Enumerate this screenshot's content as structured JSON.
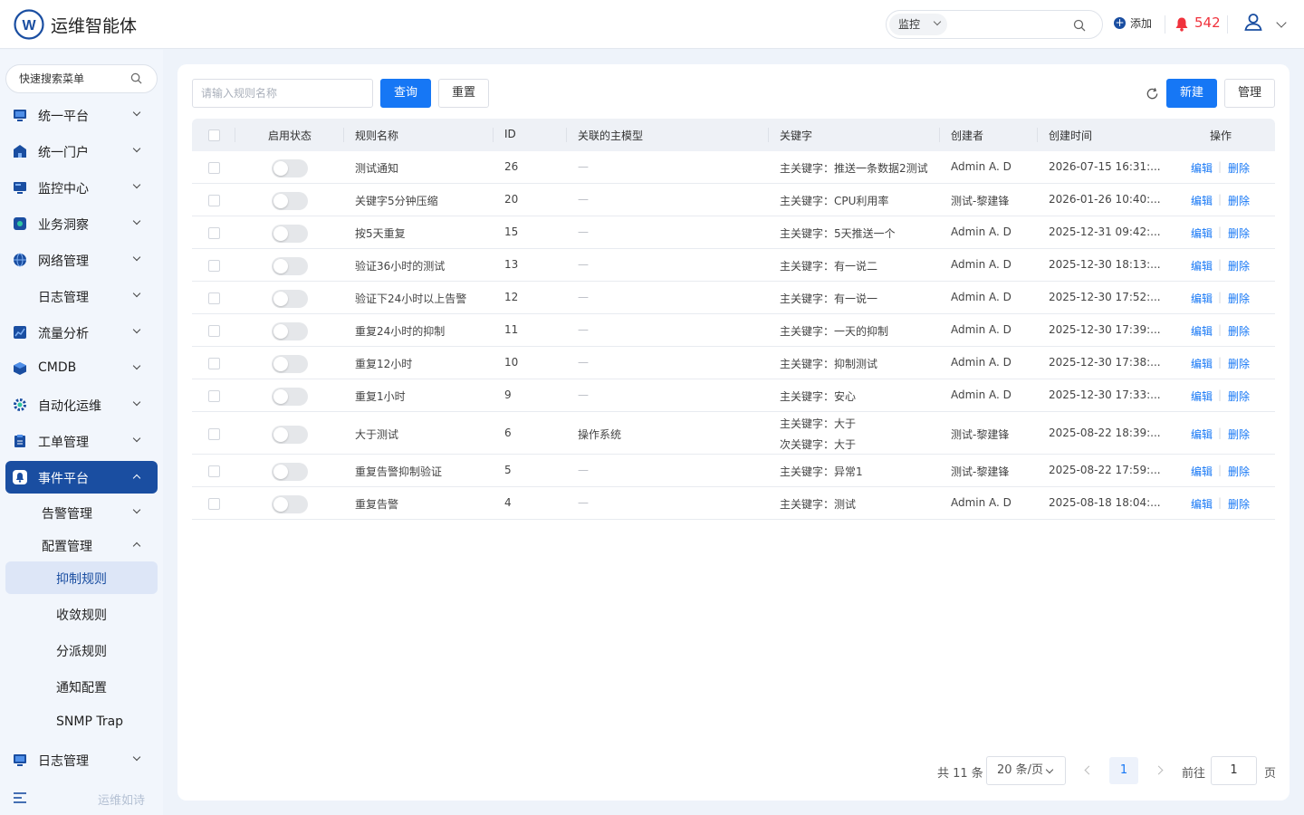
{
  "app": {
    "title": "运维智能体"
  },
  "header": {
    "search_scope": "监控",
    "add_label": "添加",
    "alert_count": "542"
  },
  "sidebar": {
    "search_placeholder": "快速搜索菜单",
    "items": [
      {
        "label": "统一平台",
        "icon": "monitor-icon"
      },
      {
        "label": "统一门户",
        "icon": "home-icon"
      },
      {
        "label": "监控中心",
        "icon": "monitor-icon"
      },
      {
        "label": "业务洞察",
        "icon": "insight-icon"
      },
      {
        "label": "网络管理",
        "icon": "globe-icon"
      },
      {
        "label": "日志管理",
        "icon": ""
      },
      {
        "label": "流量分析",
        "icon": "chart-icon"
      },
      {
        "label": "CMDB",
        "icon": "cube-icon"
      },
      {
        "label": "自动化运维",
        "icon": "gear-icon"
      },
      {
        "label": "工单管理",
        "icon": "clipboard-icon"
      },
      {
        "label": "事件平台",
        "icon": "bell-icon"
      }
    ],
    "sub_items": [
      {
        "label": "告警管理"
      },
      {
        "label": "配置管理"
      }
    ],
    "leaf_items": [
      {
        "label": "抑制规则"
      },
      {
        "label": "收敛规则"
      },
      {
        "label": "分派规则"
      },
      {
        "label": "通知配置"
      },
      {
        "label": "SNMP Trap"
      }
    ],
    "bottom_item": {
      "label": "日志管理",
      "icon": "monitor-icon"
    },
    "footer_text": "运维如诗"
  },
  "toolbar": {
    "rule_input_placeholder": "请输入规则名称",
    "query_label": "查询",
    "reset_label": "重置",
    "new_label": "新建",
    "manage_label": "管理"
  },
  "table": {
    "columns": [
      "启用状态",
      "规则名称",
      "ID",
      "关联的主模型",
      "关键字",
      "创建者",
      "创建时间",
      "操作"
    ],
    "edit_label": "编辑",
    "delete_label": "删除",
    "link_sep": "|",
    "rows": [
      {
        "enabled": false,
        "name": "测试通知",
        "id": "26",
        "model": "—",
        "keywords": [
          "主关键字：推送一条数据2测试"
        ],
        "creator": "Admin A. D",
        "created": "2026-07-15 16:31:..."
      },
      {
        "enabled": false,
        "name": "关键字5分钟压缩",
        "id": "20",
        "model": "—",
        "keywords": [
          "主关键字：CPU利用率"
        ],
        "creator": "测试-黎建锋",
        "created": "2026-01-26 10:40:..."
      },
      {
        "enabled": false,
        "name": "按5天重复",
        "id": "15",
        "model": "—",
        "keywords": [
          "主关键字：5天推送一个"
        ],
        "creator": "Admin A. D",
        "created": "2025-12-31 09:42:..."
      },
      {
        "enabled": false,
        "name": "验证36小时的测试",
        "id": "13",
        "model": "—",
        "keywords": [
          "主关键字：有一说二"
        ],
        "creator": "Admin A. D",
        "created": "2025-12-30 18:13:..."
      },
      {
        "enabled": false,
        "name": "验证下24小时以上告警",
        "id": "12",
        "model": "—",
        "keywords": [
          "主关键字：有一说一"
        ],
        "creator": "Admin A. D",
        "created": "2025-12-30 17:52:..."
      },
      {
        "enabled": false,
        "name": "重复24小时的抑制",
        "id": "11",
        "model": "—",
        "keywords": [
          "主关键字：一天的抑制"
        ],
        "creator": "Admin A. D",
        "created": "2025-12-30 17:39:..."
      },
      {
        "enabled": false,
        "name": "重复12小时",
        "id": "10",
        "model": "—",
        "keywords": [
          "主关键字：抑制测试"
        ],
        "creator": "Admin A. D",
        "created": "2025-12-30 17:38:..."
      },
      {
        "enabled": false,
        "name": "重复1小时",
        "id": "9",
        "model": "—",
        "keywords": [
          "主关键字：安心"
        ],
        "creator": "Admin A. D",
        "created": "2025-12-30 17:33:..."
      },
      {
        "enabled": false,
        "name": "大于测试",
        "id": "6",
        "model": "操作系统",
        "keywords": [
          "主关键字：大于",
          "次关键字：大于"
        ],
        "creator": "测试-黎建锋",
        "created": "2025-08-22 18:39:..."
      },
      {
        "enabled": false,
        "name": "重复告警抑制验证",
        "id": "5",
        "model": "—",
        "keywords": [
          "主关键字：异常1"
        ],
        "creator": "测试-黎建锋",
        "created": "2025-08-22 17:59:..."
      },
      {
        "enabled": false,
        "name": "重复告警",
        "id": "4",
        "model": "—",
        "keywords": [
          "主关键字：测试"
        ],
        "creator": "Admin A. D",
        "created": "2025-08-18 18:04:..."
      }
    ]
  },
  "pagination": {
    "total_text": "共 11 条",
    "page_size": "20 条/页",
    "current_page": "1",
    "goto_label": "前往",
    "goto_value": "1",
    "page_unit": "页"
  },
  "colors": {
    "primary": "#1677f5",
    "brand_dark": "#1a4ea1",
    "alert": "#f0323c"
  }
}
